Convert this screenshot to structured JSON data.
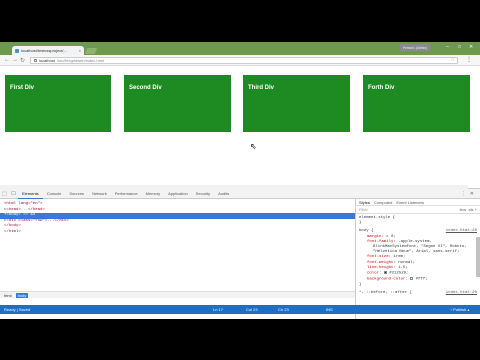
{
  "browser": {
    "tab_title": "localhost/testcssproject/...",
    "tab_close": "×",
    "profile_label": "Person1 (Admin)",
    "window_controls": [
      "–",
      "□",
      "✕"
    ],
    "url_host": "localhost",
    "url_path": "/src/flexgridweb/index.html",
    "nav": [
      "←",
      "→",
      "↻"
    ],
    "menu": "⋮"
  },
  "page": {
    "boxes": [
      {
        "label": "First Div"
      },
      {
        "label": "Second Div"
      },
      {
        "label": "Third Div"
      },
      {
        "label": "Forth Div"
      }
    ],
    "box_color": "#1e8a22"
  },
  "devtools": {
    "tools": [
      "⬚",
      "☐"
    ],
    "tabs": [
      "Elements",
      "Console",
      "Sources",
      "Network",
      "Performance",
      "Memory",
      "Application",
      "Security",
      "Audits"
    ],
    "active_tab": "Elements",
    "right_icons": [
      "⋮",
      "✕"
    ],
    "dom_lines": [
      "<html lang=\"en\">",
      "▸<head>...</head>",
      "▾<body> == $0",
      "  ▸<div class=\"row\">...</div>",
      "  </body>",
      "</html>"
    ],
    "breadcrumbs": [
      "html",
      "body"
    ],
    "styles_tabs": [
      "Styles",
      "Computed",
      "Event Listeners"
    ],
    "filter_placeholder": "Filter",
    "filter_right": ":hov  .cls  +",
    "element_style": "element.style {",
    "element_style_close": "}",
    "body_rule_selector": "body {",
    "body_rule_source": "index.html:20",
    "body_props": [
      {
        "name": "margin",
        "value": "▸ 0;"
      },
      {
        "name": "font-family",
        "value": "-apple-system,"
      },
      {
        "name": "",
        "value": "BlinkMacSystemFont, \"Segoe UI\", Roboto,"
      },
      {
        "name": "",
        "value": "\"Helvetica Neue\", Arial, sans-serif;"
      },
      {
        "name": "font-size",
        "value": "1rem;"
      },
      {
        "name": "font-weight",
        "value": "normal;"
      },
      {
        "name": "line-height",
        "value": "1.5;"
      },
      {
        "name": "color",
        "value": "#212529;"
      },
      {
        "name": "background-color",
        "value": "#fff;"
      }
    ],
    "body_rule_close": "}",
    "next_rule": "*, ::before, ::after {",
    "next_rule_source": "index.html:20"
  },
  "status": {
    "left": "Ready | Saved",
    "ln": "Ln 17",
    "col": "Col 23",
    "ch": "Ch 23",
    "ins": "INS",
    "publish": "↑ Publish ▴"
  }
}
